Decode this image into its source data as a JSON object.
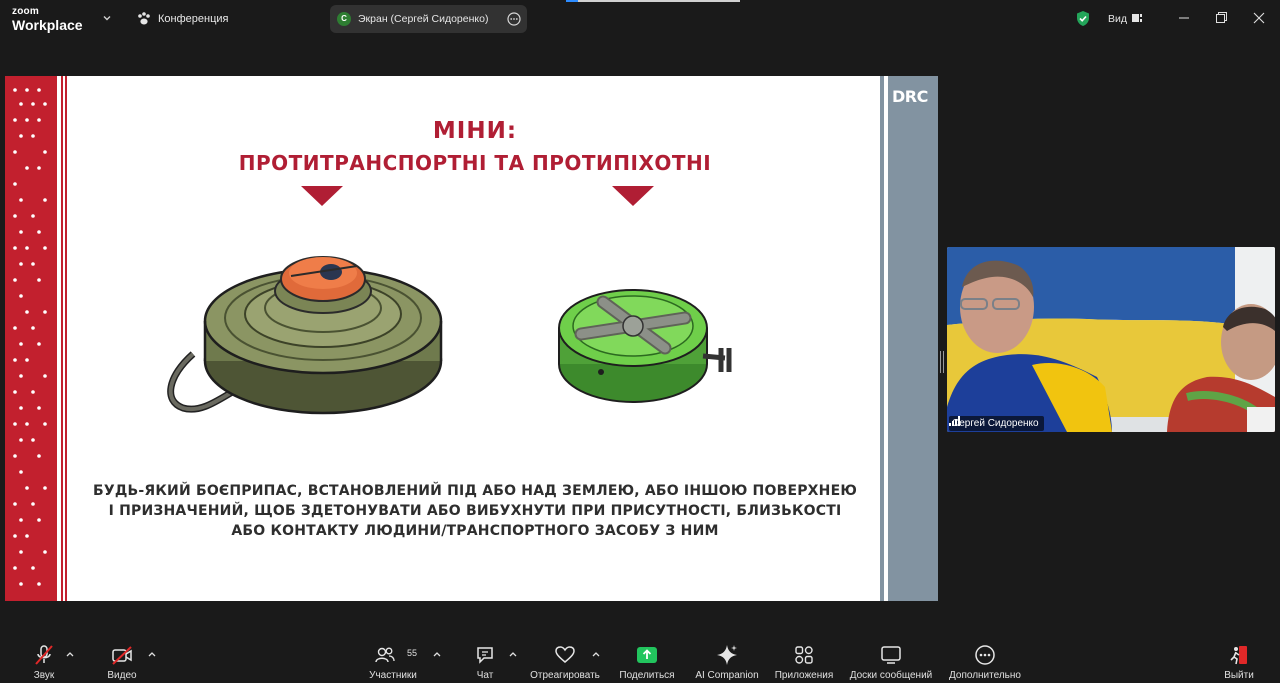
{
  "app": {
    "logo_line1": "zoom",
    "logo_line2": "Workplace",
    "meeting_title": "Конференция"
  },
  "screen_share": {
    "avatar_letter": "С",
    "label": "Экран (Сергей Сидоренко)"
  },
  "header": {
    "view_label": "Вид"
  },
  "slide": {
    "title_line1": "МІНИ:",
    "title_line2": "ПРОТИТРАНСПОРТНІ ТА ПРОТИПІХОТНІ",
    "definition_line1": "БУДЬ-ЯКИЙ БОЄПРИПАС, ВСТАНОВЛЕНИЙ ПІД АБО НАД ЗЕМЛЕЮ, АБО ІНШОЮ ПОВЕРХНЕЮ",
    "definition_line2": "І ПРИЗНАЧЕНИЙ, ЩОБ ЗДЕТОНУВАТИ АБО ВИБУХНУТИ ПРИ ПРИСУТНОСТІ, БЛИЗЬКОСТІ",
    "definition_line3": "АБО КОНТАКТУ ЛЮДИНИ/ТРАНСПОРТНОГО ЗАСОБУ З НИМ",
    "logo": "DRC",
    "accent_color": "#b01e34"
  },
  "video": {
    "participant_name": "Сергей Сидоренко"
  },
  "toolbar": {
    "audio_label": "Звук",
    "video_label": "Видео",
    "participants_label": "Участники",
    "participants_count": "55",
    "chat_label": "Чат",
    "react_label": "Отреагировать",
    "share_label": "Поделиться",
    "ai_label": "AI Companion",
    "apps_label": "Приложения",
    "whiteboards_label": "Доски сообщений",
    "more_label": "Дополнительно",
    "leave_label": "Выйти",
    "share_color": "#22c55e",
    "leave_color": "#e02828"
  }
}
